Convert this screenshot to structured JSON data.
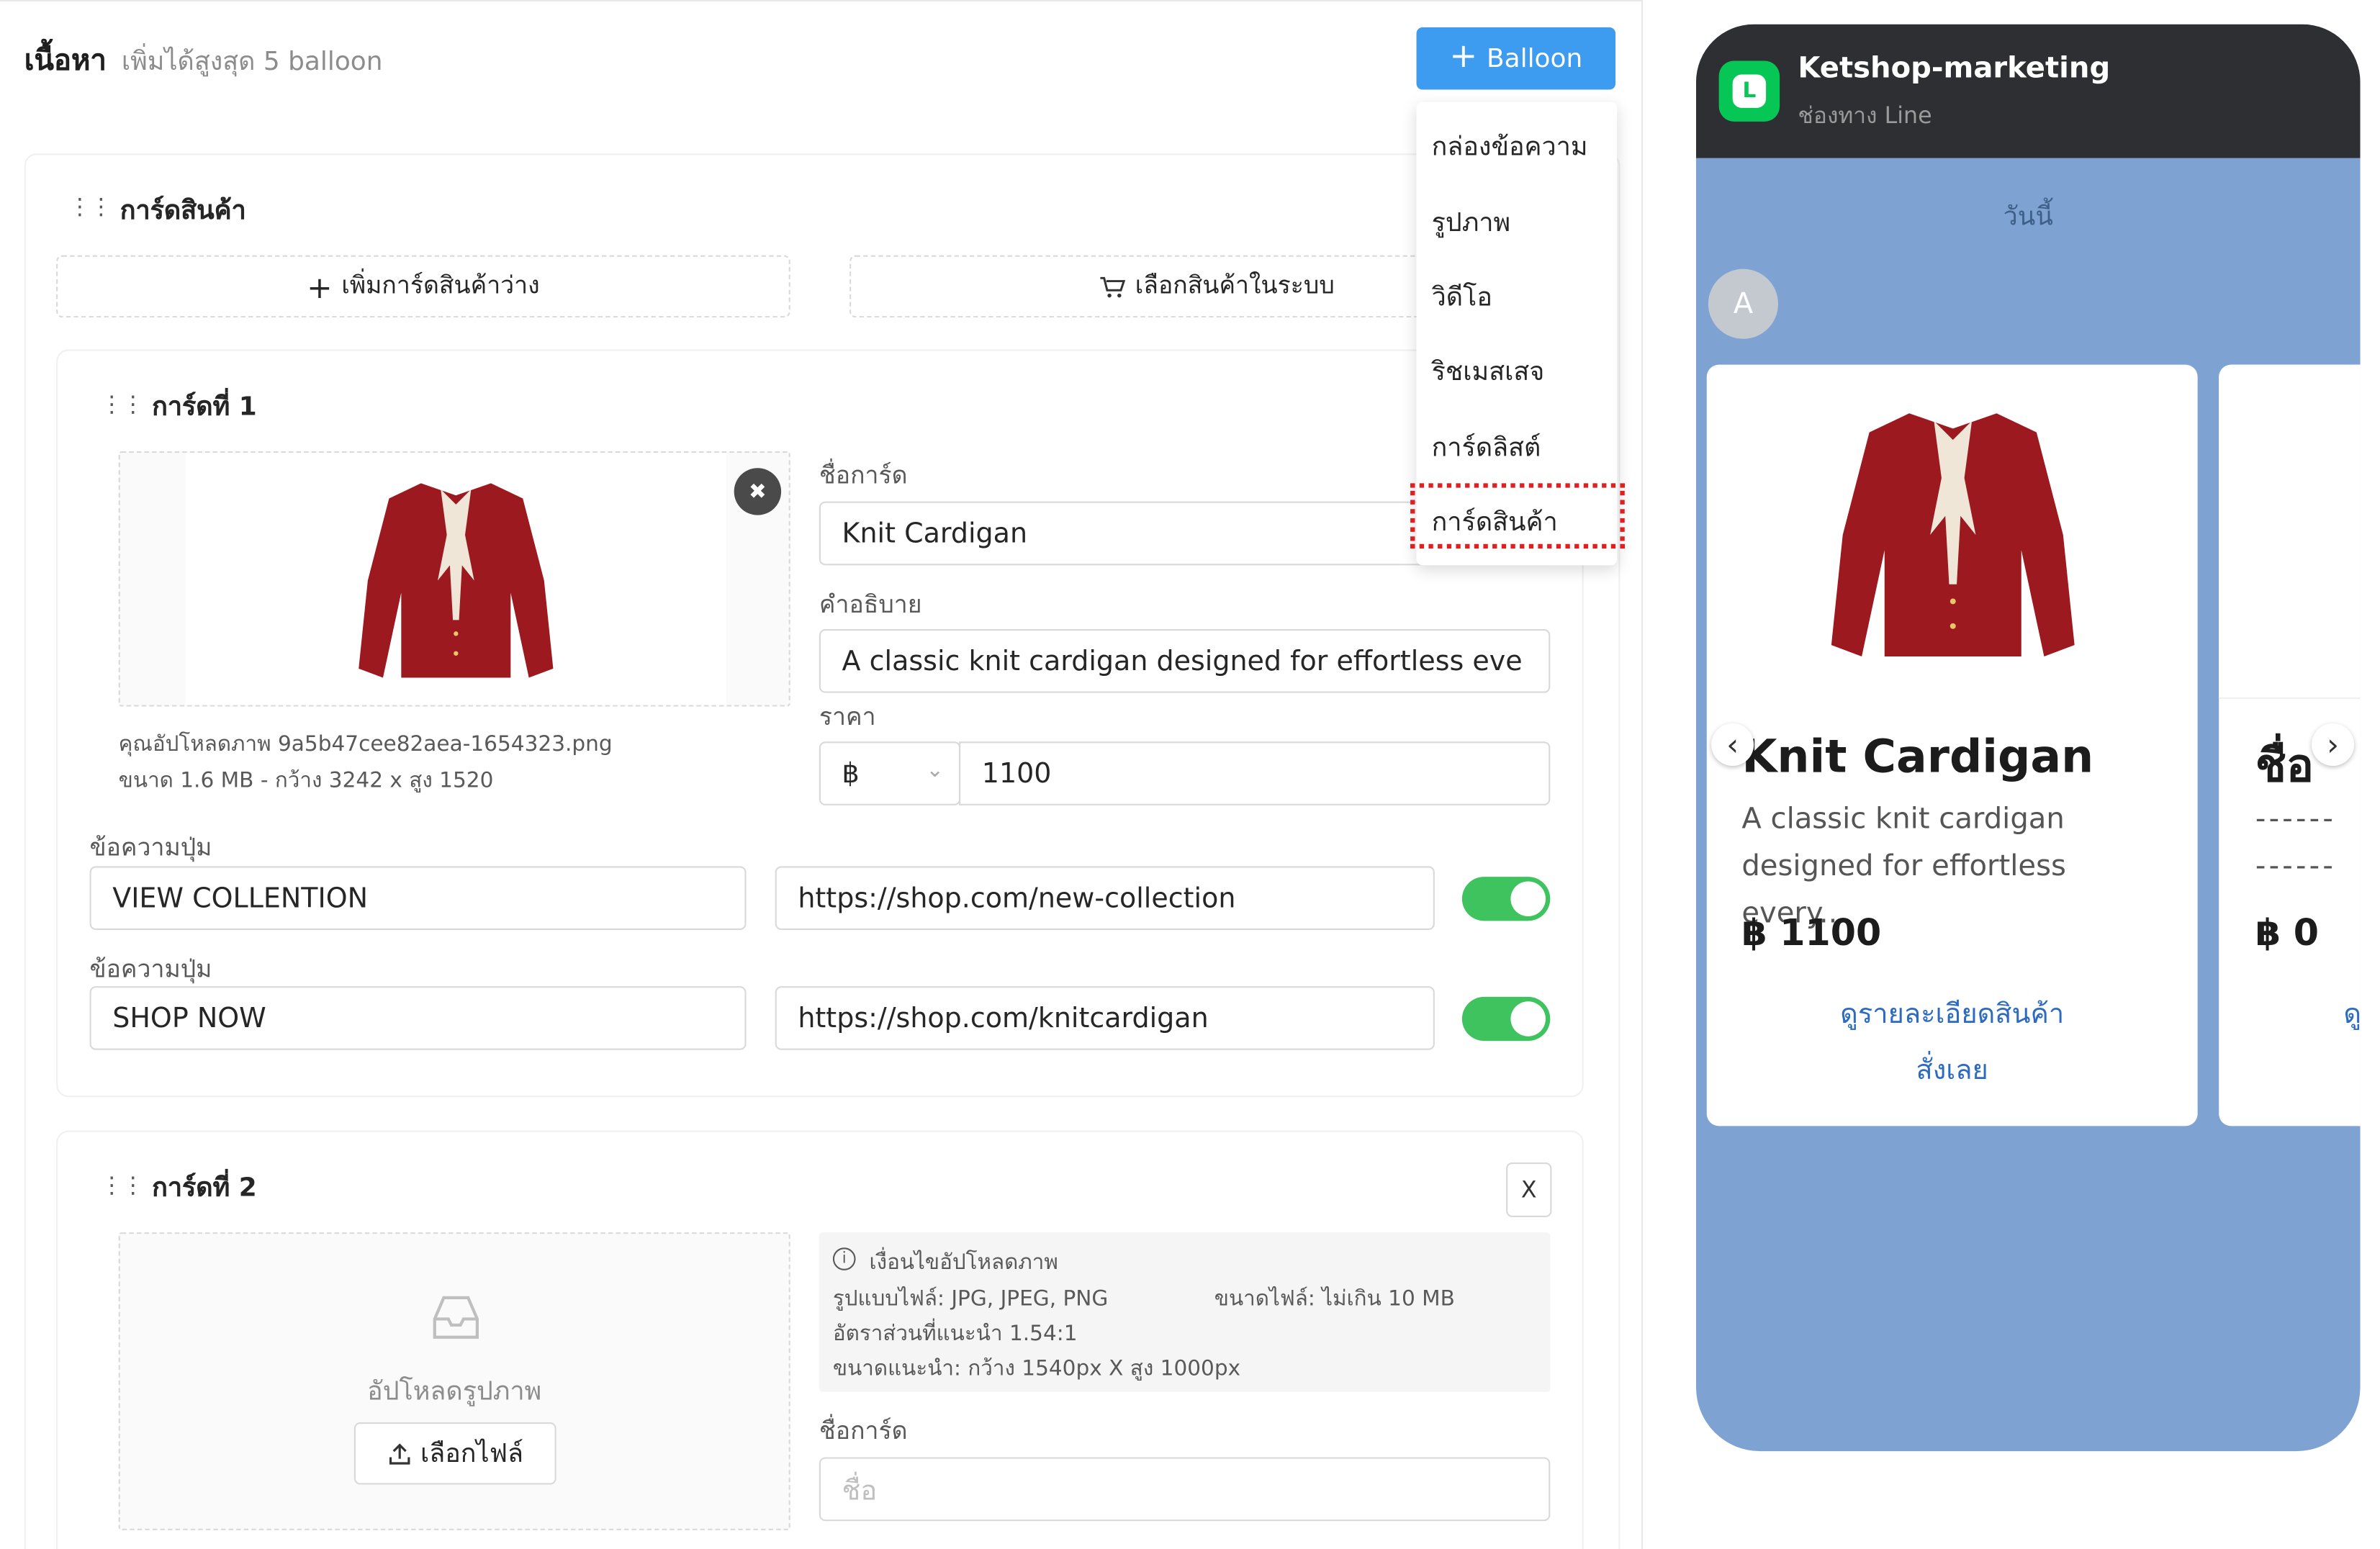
{
  "header": {
    "title": "เนื้อหา",
    "subtitle": "เพิ่มได้สูงสุด 5 balloon",
    "add_button": "Balloon"
  },
  "dropdown": {
    "items": [
      "กล่องข้อความ",
      "รูปภาพ",
      "วิดีโอ",
      "ริชเมสเสจ",
      "การ์ดลิสต์",
      "การ์ดสินค้า"
    ],
    "highlighted": "การ์ดสินค้า"
  },
  "section": {
    "title": "การ์ดสินค้า",
    "add_blank_button": "เพิ่มการ์ดสินค้าว่าง",
    "select_button": "เลือกสินค้าในระบบ"
  },
  "card1": {
    "title": "การ์ดที่ 1",
    "upload_info": "คุณอัปโหลดภาพ 9a5b47cee82aea-1654323.png",
    "upload_size": "ขนาด 1.6 MB - กว้าง 3242 x สูง 1520",
    "name_label": "ชื่อการ์ด",
    "name_value": "Knit Cardigan",
    "desc_label": "คำอธิบาย",
    "desc_value": "A classic knit cardigan designed for effortless eve",
    "price_label": "ราคา",
    "currency": "฿",
    "price_value": "1100",
    "button_label_1": "ข้อความปุ่ม",
    "button_text_1": "VIEW COLLENTION",
    "button_url_1": "https://shop.com/new-collection",
    "button_label_2": "ข้อความปุ่ม",
    "button_text_2": "SHOP NOW",
    "button_url_2": "https://shop.com/knitcardigan"
  },
  "card2": {
    "title": "การ์ดที่ 2",
    "close": "X",
    "upload_label": "อัปโหลดรูปภาพ",
    "choose_file": "เลือกไฟล์",
    "cond_title": "เงื่อนไขอัปโหลดภาพ",
    "cond_format": "รูปแบบไฟล์: JPG, JPEG, PNG",
    "cond_size": "ขนาดไฟล์: ไม่เกิน 10 MB",
    "cond_ratio": "อัตราส่วนที่แนะนำ 1.54:1",
    "cond_dims": "ขนาดแนะนำ: กว้าง 1540px X สูง 1000px",
    "name_label": "ชื่อการ์ด",
    "name_placeholder": "ชื่อ"
  },
  "preview": {
    "account": "Ketshop-marketing",
    "channel": "ช่องทาง Line",
    "day": "วันนี้",
    "avatar": "A",
    "line_logo": "L",
    "card1": {
      "name": "Knit Cardigan",
      "desc": "A classic knit cardigan designed for effortless every...",
      "price": "฿ 1100",
      "link1": "ดูรายละเอียดสินค้า",
      "link2": "สั่งเลย"
    },
    "card2": {
      "name": "ชื่อ",
      "price": "฿ 0",
      "dashes": "------",
      "link_partial": "ดู"
    }
  },
  "colors": {
    "primary": "#3d9bf0",
    "toggle_on": "#3ec35e",
    "line_green": "#06c755",
    "preview_bg": "#7ea3d2",
    "highlight": "#e02020"
  }
}
